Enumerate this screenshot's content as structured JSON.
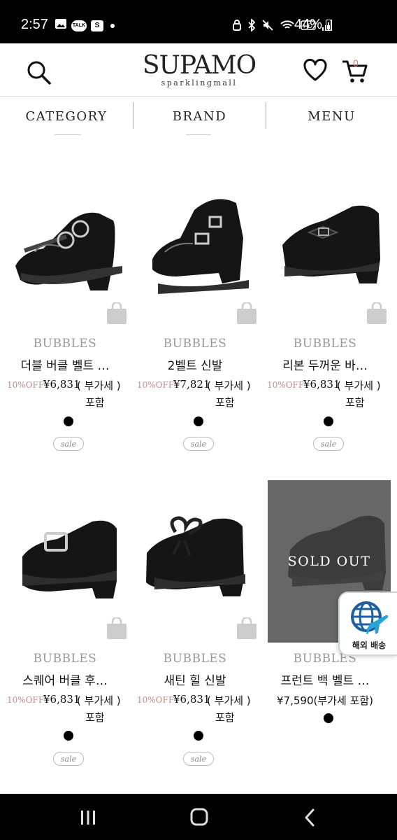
{
  "status_bar": {
    "time": "2:57",
    "battery": "44%",
    "left_icons": [
      "gallery-icon",
      "talk-icon",
      "s-icon"
    ],
    "talk_label": "TALK",
    "s_label": "S"
  },
  "header": {
    "logo": "SUPAMO",
    "logo_sub": "sparklingmall",
    "cart_count": "0"
  },
  "nav": {
    "category": "CATEGORY",
    "brand": "BRAND",
    "menu": "MENU"
  },
  "products": [
    {
      "brand": "BUBBLES",
      "title": "더블 버클 벨트 …",
      "discount": "10%OFF",
      "price": "¥6,831",
      "vat1": "( 부가세 )",
      "vat2": "포함",
      "sale": "sale"
    },
    {
      "brand": "BUBBLES",
      "title": "2벨트 신발",
      "discount": "10%OFF",
      "price": "¥7,821",
      "vat1": "( 부가세 )",
      "vat2": "포함",
      "sale": "sale"
    },
    {
      "brand": "BUBBLES",
      "title": "리본 두꺼운 바…",
      "discount": "10%OFF",
      "price": "¥6,831",
      "vat1": "( 부가세 )",
      "vat2": "포함",
      "sale": "sale"
    },
    {
      "brand": "BUBBLES",
      "title": "스퀘어 버클 후…",
      "discount": "10%OFF",
      "price": "¥6,831",
      "vat1": "( 부가세 )",
      "vat2": "포함",
      "sale": "sale"
    },
    {
      "brand": "BUBBLES",
      "title": "새틴 힐 신발",
      "discount": "10%OFF",
      "price": "¥6,831",
      "vat1": "( 부가세 )",
      "vat2": "포함",
      "sale": "sale"
    },
    {
      "brand": "BUBBLES",
      "title": "프런트 백 벨트 …",
      "price_full": "¥7,590(부가세 포함)",
      "soldout": "SOLD OUT"
    }
  ],
  "overseas": {
    "label": "해외 배송"
  },
  "colors": {
    "accent_pink": "#e4727a",
    "discount": "#c98a8a",
    "brand_gray": "#999999"
  }
}
